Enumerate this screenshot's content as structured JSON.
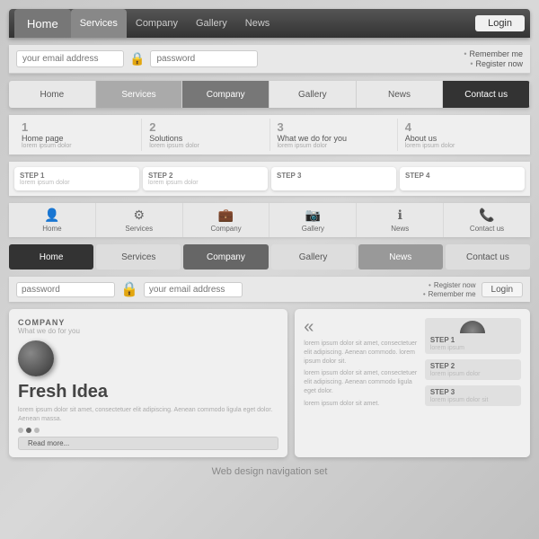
{
  "nav1": {
    "tabs": [
      {
        "label": "Home",
        "class": "home"
      },
      {
        "label": "Services",
        "class": "active"
      },
      {
        "label": "Company",
        "class": ""
      },
      {
        "label": "Gallery",
        "class": ""
      },
      {
        "label": "News",
        "class": ""
      }
    ],
    "login_label": "Login"
  },
  "login_bar": {
    "email_placeholder": "your email address",
    "password_placeholder": "password",
    "remember_me": "Remember me",
    "register_now": "Register now"
  },
  "nav2": {
    "tabs": [
      {
        "label": "Home",
        "class": ""
      },
      {
        "label": "Services",
        "class": "active-svc"
      },
      {
        "label": "Company",
        "class": "active-comp"
      },
      {
        "label": "Gallery",
        "class": ""
      },
      {
        "label": "News",
        "class": ""
      },
      {
        "label": "Contact us",
        "class": "active-contact"
      }
    ]
  },
  "sub_menu": {
    "items": [
      {
        "num": "1",
        "title": "Home page",
        "desc": "lorem ipsum dolor"
      },
      {
        "num": "2",
        "title": "Solutions",
        "desc": "lorem ipsum dolor"
      },
      {
        "num": "3",
        "title": "What we do for you",
        "desc": "lorem ipsum dolor"
      },
      {
        "num": "4",
        "title": "About us",
        "desc": "lorem ipsum dolor"
      }
    ]
  },
  "step_bar": {
    "steps": [
      {
        "label": "STEP 1",
        "desc": "lorem ipsum dolor"
      },
      {
        "label": "STEP 2",
        "desc": "lorem ipsum dolor"
      },
      {
        "label": "STEP 3",
        "desc": ""
      },
      {
        "label": "STEP 4",
        "desc": ""
      }
    ]
  },
  "icon_nav": {
    "tabs": [
      {
        "label": "Home",
        "icon": "👤"
      },
      {
        "label": "Services",
        "icon": "⚙"
      },
      {
        "label": "Company",
        "icon": "💼"
      },
      {
        "label": "Gallery",
        "icon": "📷"
      },
      {
        "label": "News",
        "icon": "ℹ"
      },
      {
        "label": "Contact us",
        "icon": "📞"
      }
    ]
  },
  "nav3": {
    "tabs": [
      {
        "label": "Home",
        "class": "active-home"
      },
      {
        "label": "Services",
        "class": ""
      },
      {
        "label": "Company",
        "class": "active-comp"
      },
      {
        "label": "Gallery",
        "class": ""
      },
      {
        "label": "News",
        "class": "active-news"
      },
      {
        "label": "Contact us",
        "class": ""
      }
    ]
  },
  "login_bar2": {
    "password_placeholder": "password",
    "email_placeholder": "your email address",
    "register_now": "Register now",
    "remember_me": "Remember me",
    "login_label": "Login"
  },
  "card1": {
    "company_label": "COMPANY",
    "sub_label": "What we do for you",
    "fresh_idea": "Fresh Idea",
    "lorem_text": "lorem ipsum dolor sit amet, consectetuer elit adipiscing.\nAenean commodo ligula eget dolor. Aenean massa.",
    "read_more": "Read more..."
  },
  "card2": {
    "arrow": "«",
    "bullet_items": [
      "lorem ipsum dolor sit amet, consectetuer elit adipiscing. Aenean commodo. lorem ipsum dolor sit.",
      "lorem ipsum dolor sit amet, consectetuer elit adipiscing. Aenean commodo ligula eget dolor.",
      "lorem ipsum dolor sit amet."
    ],
    "steps": [
      {
        "label": "STEP 1",
        "desc": "lorem ipsum"
      },
      {
        "label": "STEP 2",
        "desc": "lorem ipsum dolor"
      },
      {
        "label": "STEP 3",
        "desc": "lorem ipsum dolor sit"
      }
    ]
  },
  "footer": {
    "label": "Web design navigation set"
  }
}
